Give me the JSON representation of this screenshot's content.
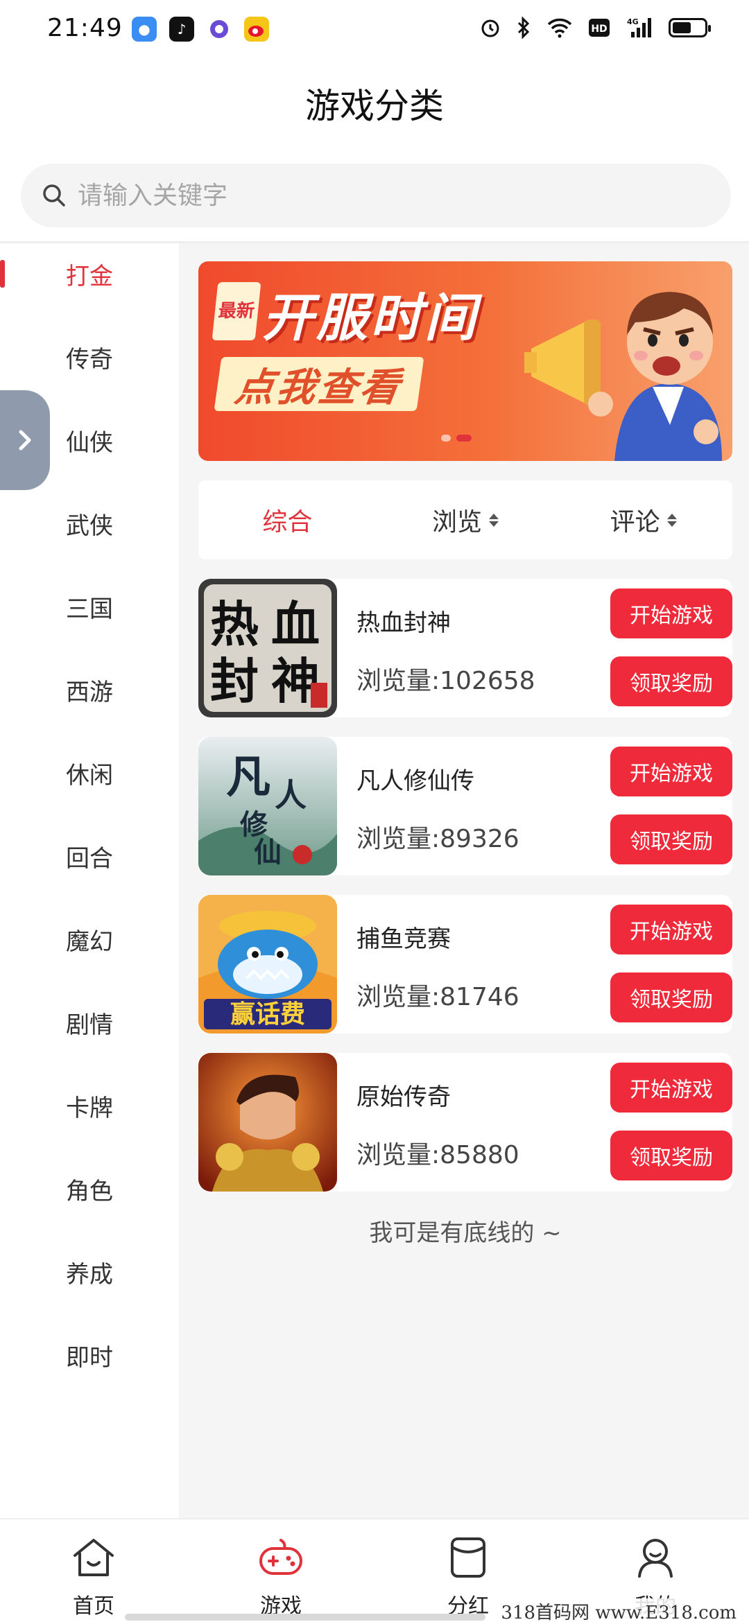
{
  "status_bar": {
    "time": "21:49",
    "right_icons": [
      "alarm-icon",
      "bluetooth-icon",
      "wifi-icon",
      "hd-icon",
      "4g-signal-icon",
      "battery-icon"
    ]
  },
  "header": {
    "title": "游戏分类"
  },
  "search": {
    "placeholder": "请输入关键字",
    "value": ""
  },
  "sidebar": {
    "items": [
      {
        "label": "打金",
        "active": true
      },
      {
        "label": "传奇"
      },
      {
        "label": "仙侠"
      },
      {
        "label": "武侠"
      },
      {
        "label": "三国"
      },
      {
        "label": "西游"
      },
      {
        "label": "休闲"
      },
      {
        "label": "回合"
      },
      {
        "label": "魔幻"
      },
      {
        "label": "剧情"
      },
      {
        "label": "卡牌"
      },
      {
        "label": "角色"
      },
      {
        "label": "养成"
      },
      {
        "label": "即时"
      }
    ]
  },
  "banner": {
    "tag": "最新",
    "title": "开服时间",
    "subtitle": "点我查看"
  },
  "sort_tabs": [
    {
      "label": "综合",
      "active": true
    },
    {
      "label": "浏览",
      "sortable": true
    },
    {
      "label": "评论",
      "sortable": true
    }
  ],
  "games": [
    {
      "name": "热血封神",
      "views": "浏览量:102658",
      "thumb_text": [
        "热",
        "血",
        "封",
        "神"
      ],
      "play_label": "开始游戏",
      "reward_label": "领取奖励"
    },
    {
      "name": "凡人修仙传",
      "views": "浏览量:89326",
      "thumb_text": [
        "凡",
        "人",
        "修",
        "仙"
      ],
      "play_label": "开始游戏",
      "reward_label": "领取奖励"
    },
    {
      "name": "捕鱼竞赛",
      "views": "浏览量:81746",
      "thumb_text": [
        "赢话费"
      ],
      "play_label": "开始游戏",
      "reward_label": "领取奖励"
    },
    {
      "name": "原始传奇",
      "views": "浏览量:85880",
      "play_label": "开始游戏",
      "reward_label": "领取奖励"
    }
  ],
  "list_end_note": "我可是有底线的 ~",
  "bottom_nav": [
    {
      "label": "首页",
      "icon": "home-icon"
    },
    {
      "label": "游戏",
      "icon": "gamepad-icon",
      "active": true
    },
    {
      "label": "分红",
      "icon": "dividend-icon"
    },
    {
      "label": "我的",
      "icon": "profile-icon"
    }
  ],
  "watermark": "318首码网 www.E318.com",
  "colors": {
    "accent": "#e0323b",
    "button": "#ef2b3b"
  }
}
